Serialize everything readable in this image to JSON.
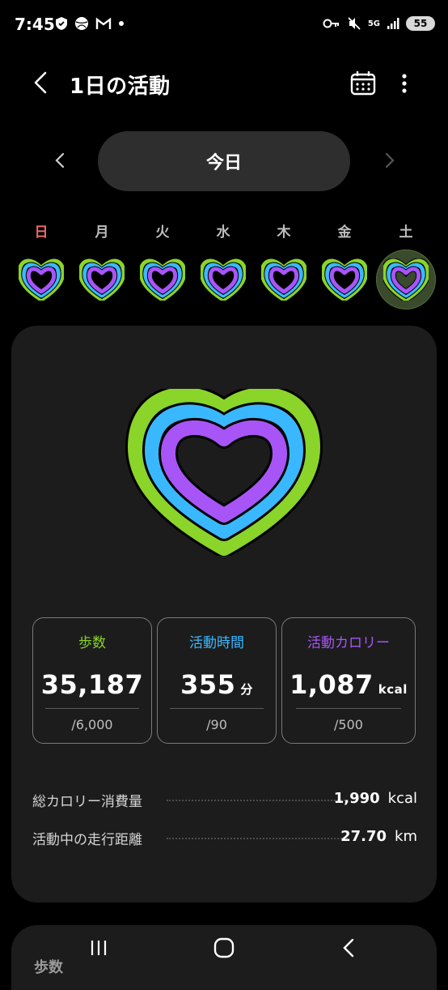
{
  "status": {
    "time": "7:45",
    "battery": "55",
    "network": "5G"
  },
  "header": {
    "title": "1日の活動"
  },
  "date_nav": {
    "current": "今日"
  },
  "week": {
    "days": [
      "日",
      "月",
      "火",
      "水",
      "木",
      "金",
      "土"
    ],
    "selected_index": 6
  },
  "colors": {
    "steps": "#8bd42a",
    "active_time": "#3ab8ff",
    "calories": "#a855f7",
    "sunday": "#e96b6b"
  },
  "stats": {
    "steps": {
      "label": "歩数",
      "value": "35,187",
      "unit": "",
      "goal": "/6,000"
    },
    "active_time": {
      "label": "活動時間",
      "value": "355",
      "unit": "分",
      "goal": "/90"
    },
    "active_calories": {
      "label": "活動カロリー",
      "value": "1,087",
      "unit": "kcal",
      "goal": "/500"
    }
  },
  "summary": {
    "total_calories": {
      "label": "総カロリー消費量",
      "value": "1,990",
      "unit": "kcal"
    },
    "distance": {
      "label": "活動中の走行距離",
      "value": "27.70",
      "unit": "km"
    }
  },
  "next_section": {
    "title": "歩数"
  }
}
